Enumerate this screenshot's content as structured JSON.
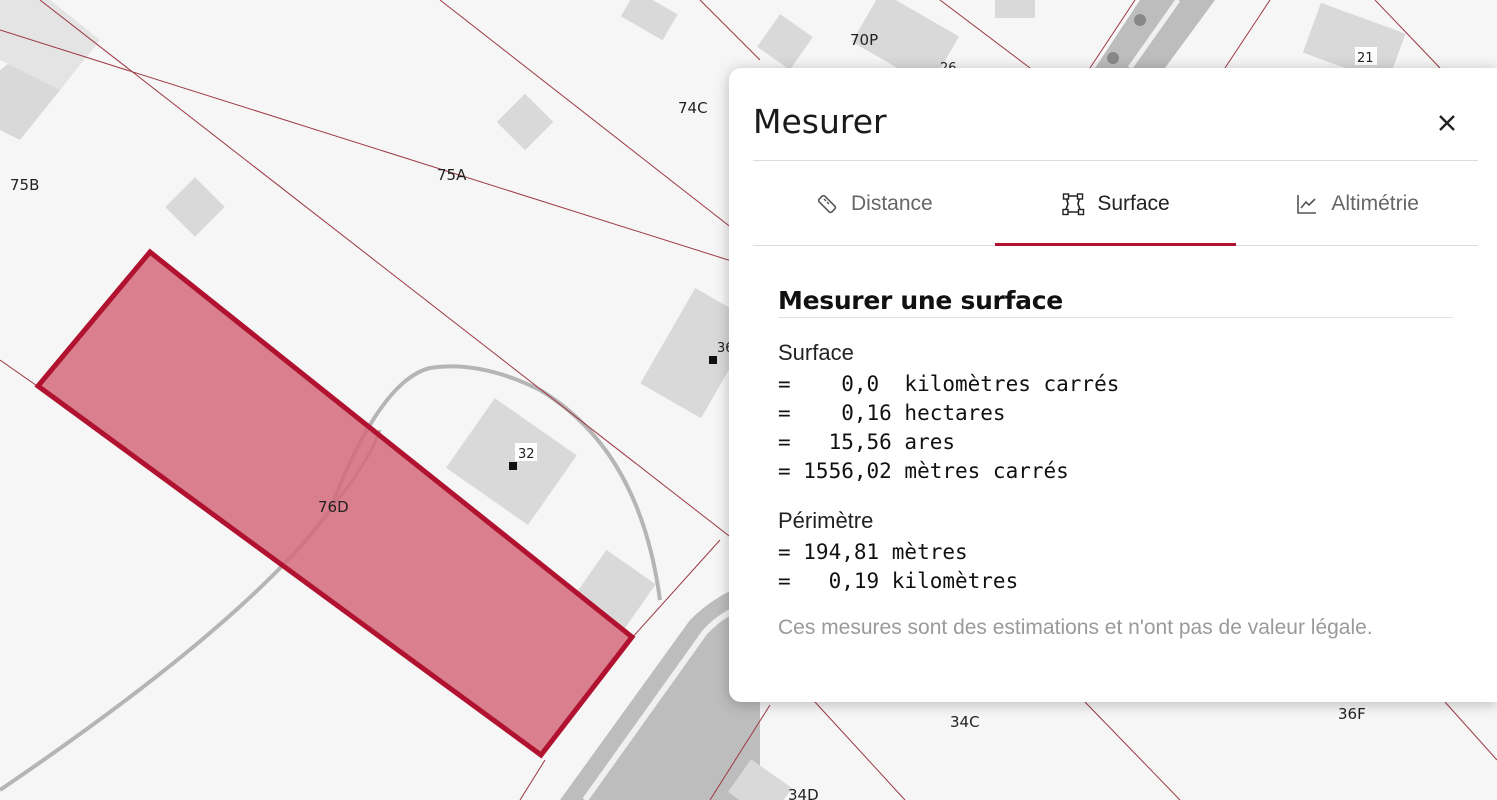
{
  "map": {
    "parcels": [
      "70P",
      "74C",
      "75A",
      "75B",
      "76D",
      "34C",
      "36F",
      "34D"
    ],
    "house_numbers": [
      "26",
      "21",
      "32",
      "36"
    ],
    "highlight_color": "#b0122f"
  },
  "panel": {
    "title": "Mesurer",
    "close_icon": "close-icon",
    "tabs": [
      {
        "label": "Distance",
        "icon": "ruler-icon",
        "active": false
      },
      {
        "label": "Surface",
        "icon": "polygon-icon",
        "active": true
      },
      {
        "label": "Altimétrie",
        "icon": "chart-line-icon",
        "active": false
      }
    ],
    "section_title": "Mesurer une surface",
    "surface_label": "Surface",
    "surface_lines": [
      "=    0,0  kilomètres carrés",
      "=    0,16 hectares",
      "=   15,56 ares",
      "= 1556,02 mètres carrés"
    ],
    "perimeter_label": "Périmètre",
    "perimeter_lines": [
      "= 194,81 mètres",
      "=   0,19 kilomètres"
    ],
    "disclaimer": "Ces mesures sont des estimations et n'ont pas de valeur légale."
  }
}
